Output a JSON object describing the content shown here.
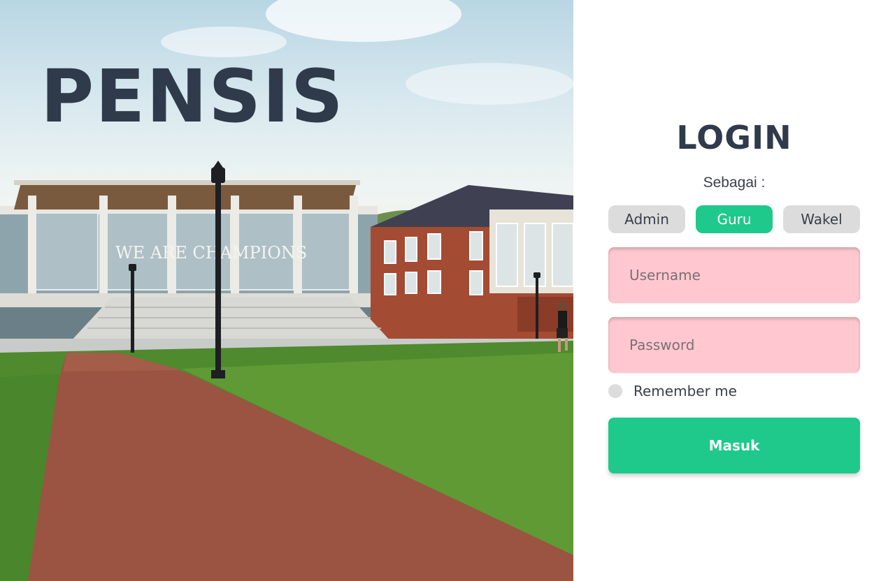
{
  "brand": {
    "title": "PENSIS"
  },
  "hero": {
    "building_sign": "WE ARE CHAMPIONS"
  },
  "login": {
    "title": "LOGIN",
    "role_label": "Sebagai :",
    "roles": [
      {
        "label": "Admin",
        "selected": false
      },
      {
        "label": "Guru",
        "selected": true
      },
      {
        "label": "Wakel",
        "selected": false
      }
    ],
    "username": {
      "placeholder": "Username",
      "value": ""
    },
    "password": {
      "placeholder": "Password",
      "value": ""
    },
    "remember_label": "Remember me",
    "submit_label": "Masuk"
  },
  "colors": {
    "accent": "#1ec98b",
    "input_bg": "#ffc8d0",
    "inactive_role": "#dcdcdc",
    "text_dark": "#2f3a4b"
  },
  "icons": {
    "remember": "radio-circle"
  }
}
